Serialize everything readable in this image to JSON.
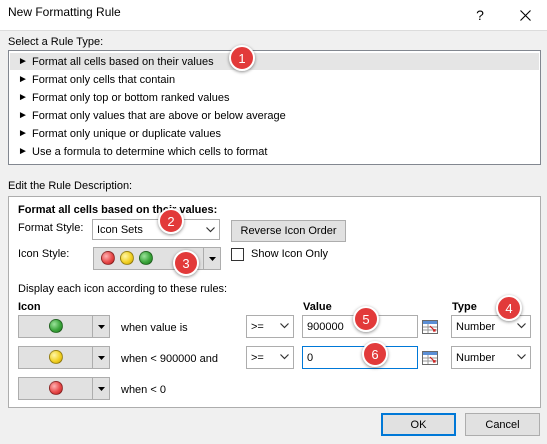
{
  "window": {
    "title": "New Formatting Rule",
    "help_glyph": "?",
    "close_glyph": "✕"
  },
  "rule_type": {
    "label": "Select a Rule Type:",
    "items": [
      {
        "text": "Format all cells based on their values",
        "selected": true
      },
      {
        "text": "Format only cells that contain",
        "selected": false
      },
      {
        "text": "Format only top or bottom ranked values",
        "selected": false
      },
      {
        "text": "Format only values that are above or below average",
        "selected": false
      },
      {
        "text": "Format only unique or duplicate values",
        "selected": false
      },
      {
        "text": "Use a formula to determine which cells to format",
        "selected": false
      }
    ],
    "arrow_glyph": "►"
  },
  "description": {
    "label": "Edit the Rule Description:",
    "heading": "Format all cells based on their values:",
    "format_style_label": "Format Style:",
    "format_style_value": "Icon Sets",
    "reverse_icon_order": "Reverse Icon Order",
    "icon_style_label": "Icon Style:",
    "show_icon_only": "Show Icon Only",
    "show_icon_only_checked": false,
    "display_rules_text": "Display each icon according to these rules:",
    "col_icon": "Icon",
    "col_value": "Value",
    "col_type": "Type",
    "rows": [
      {
        "icon": "green-circle",
        "condition": "when value is",
        "operator": ">=",
        "value": "900000",
        "type": "Number"
      },
      {
        "icon": "yellow-circle",
        "condition": "when < 900000 and",
        "operator": ">=",
        "value": "0",
        "type": "Number"
      },
      {
        "icon": "red-circle",
        "condition": "when < 0"
      }
    ]
  },
  "buttons": {
    "ok": "OK",
    "cancel": "Cancel"
  },
  "badges": [
    "1",
    "2",
    "3",
    "4",
    "5",
    "6"
  ],
  "colors": {
    "badge": "#e23a3a",
    "focus_border": "#0078d7",
    "selection": "#e5e5e5"
  }
}
